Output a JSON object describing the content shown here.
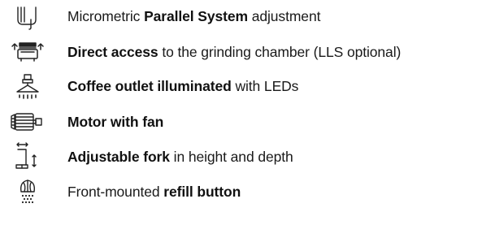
{
  "features": [
    {
      "icon": "parallel-system-icon",
      "before": "Micrometric ",
      "bold": "Parallel System",
      "after": " adjustment"
    },
    {
      "icon": "grinding-chamber-access-icon",
      "before": "",
      "bold": "Direct access",
      "after": " to the grinding chamber (LLS optional)"
    },
    {
      "icon": "illuminated-outlet-icon",
      "before": "",
      "bold": "Coffee outlet illuminated",
      "after": " with LEDs"
    },
    {
      "icon": "motor-fan-icon",
      "before": "",
      "bold": "Motor with fan",
      "after": ""
    },
    {
      "icon": "adjustable-fork-icon",
      "before": "",
      "bold": "Adjustable fork",
      "after": " in height and depth"
    },
    {
      "icon": "refill-button-icon",
      "before": "Front-mounted ",
      "bold": "refill button",
      "after": ""
    }
  ]
}
